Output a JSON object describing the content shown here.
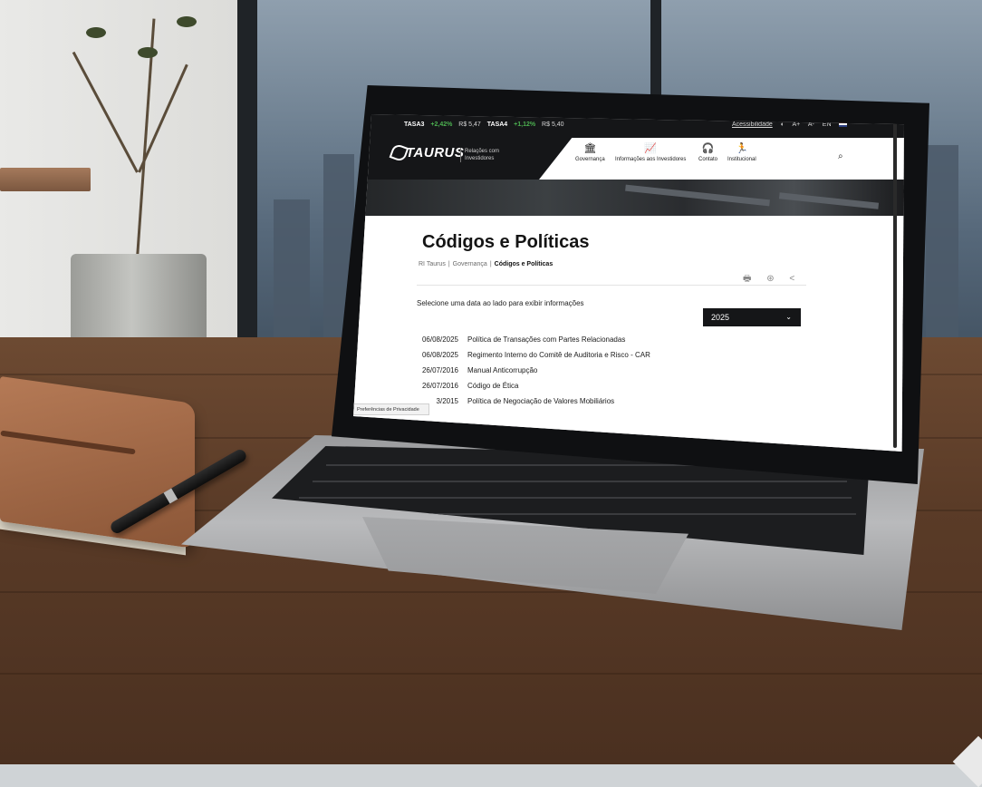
{
  "topbar": {
    "ticker": [
      {
        "symbol": "TASA3",
        "change": "+2,42%",
        "price": "R$ 5,47"
      },
      {
        "symbol": "TASA4",
        "change": "+1,12%",
        "price": "R$ 5,40"
      }
    ],
    "accessibility": "Acessibilidade",
    "font_up": "A+",
    "font_down": "A-",
    "language": "EN"
  },
  "header": {
    "logo": "TAURUS",
    "subtitle": "Relações com Investidores",
    "nav": [
      {
        "label": "Governança",
        "icon": "bank-icon"
      },
      {
        "label": "Informações aos Investidores",
        "icon": "chart-icon"
      },
      {
        "label": "Contato",
        "icon": "headset-icon"
      },
      {
        "label": "Institucional",
        "icon": "person-icon"
      }
    ]
  },
  "page": {
    "title": "Códigos e Políticas",
    "breadcrumb": [
      "RI Taurus",
      "Governança",
      "Códigos e Políticas"
    ],
    "select_label": "Selecione uma data ao lado para exibir informações",
    "year": "2025",
    "documents": [
      {
        "date": "06/08/2025",
        "title": "Política de Transações com Partes Relacionadas"
      },
      {
        "date": "06/08/2025",
        "title": "Regimento Interno do Comitê de Auditoria e Risco - CAR"
      },
      {
        "date": "26/07/2016",
        "title": "Manual Anticorrupção"
      },
      {
        "date": "26/07/2016",
        "title": "Código de Ética"
      },
      {
        "date": "3/2015",
        "title": "Política de Negociação de Valores Mobiliários"
      }
    ],
    "privacy": "Preferências de Privacidade"
  },
  "colors": {
    "dark": "#151618",
    "positive": "#4cb050",
    "accent_white": "#ffffff"
  }
}
